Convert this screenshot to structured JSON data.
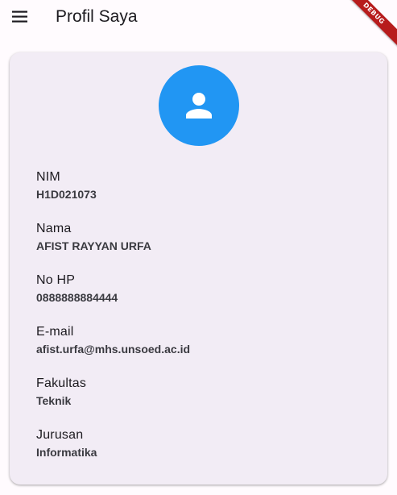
{
  "appbar": {
    "title": "Profil Saya",
    "menu_icon": "menu-icon",
    "debug_banner": "DEBUG"
  },
  "profile": {
    "avatar_icon": "person-icon",
    "avatar_color": "#2196f3",
    "fields": [
      {
        "label": "NIM",
        "value": "H1D021073"
      },
      {
        "label": "Nama",
        "value": "AFIST RAYYAN URFA"
      },
      {
        "label": "No HP",
        "value": "0888888884444"
      },
      {
        "label": "E-mail",
        "value": "afist.urfa@mhs.unsoed.ac.id"
      },
      {
        "label": "Fakultas",
        "value": "Teknik"
      },
      {
        "label": "Jurusan",
        "value": "Informatika"
      }
    ]
  }
}
